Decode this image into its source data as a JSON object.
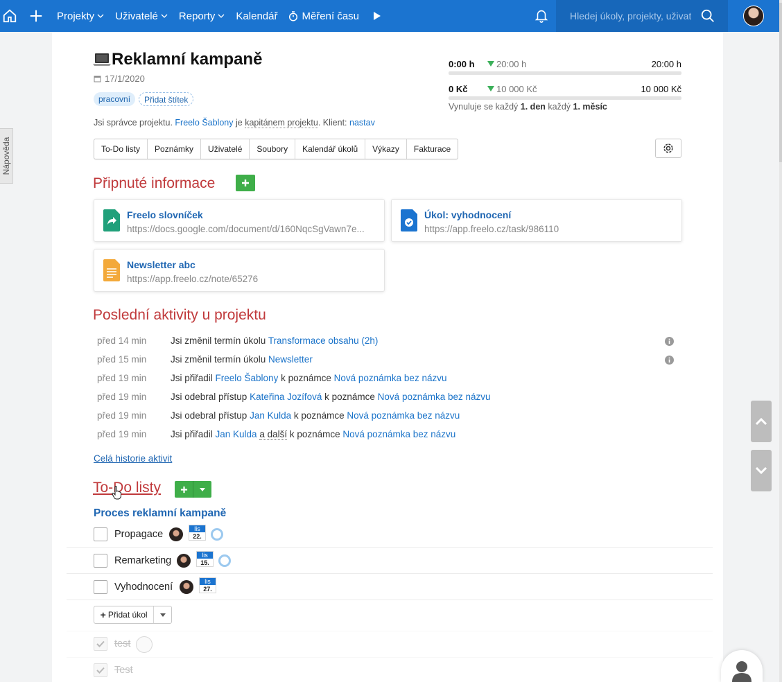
{
  "topnav": {
    "items": [
      {
        "label": "Projekty",
        "dropdown": true
      },
      {
        "label": "Uživatelé",
        "dropdown": true
      },
      {
        "label": "Reporty",
        "dropdown": true
      },
      {
        "label": "Kalendář",
        "dropdown": false
      },
      {
        "label": "Měření času",
        "dropdown": false
      }
    ],
    "search_placeholder": "Hledej úkoly, projekty, uživatele",
    "brand_color": "#1b74d0"
  },
  "help_tab": "Nápověda",
  "project": {
    "icon": "laptop-icon",
    "title": "Reklamní kampaně",
    "date": "17/1/2020",
    "tags": [
      "pracovní"
    ],
    "add_tag": "Přidat štítek",
    "info": {
      "prefix": "Jsi správce projektu.",
      "captain": "Freelo Šablony",
      "middle": "je",
      "captain_role": "kapitánem projektu",
      "client_label": ". Klient:",
      "client_action": "nastav"
    }
  },
  "budget": {
    "time": {
      "spent": "0:00 h",
      "estimate": "20:00 h",
      "total": "20:00 h"
    },
    "money": {
      "spent": "0 Kč",
      "estimate": "10 000 Kč",
      "total": "10 000 Kč"
    },
    "reset": {
      "prefix": "Vynuluje se každý",
      "day": "1. den",
      "middle": "každý",
      "month": "1. měsíc"
    }
  },
  "tabs": [
    "To-Do listy",
    "Poznámky",
    "Uživatelé",
    "Soubory",
    "Kalendář úkolů",
    "Výkazy",
    "Fakturace"
  ],
  "pinned": {
    "heading": "Připnuté informace",
    "items": [
      {
        "icon": "shared-link-icon",
        "title": "Freelo slovníček",
        "url": "https://docs.google.com/document/d/160NqcSgVawn7e..."
      },
      {
        "icon": "task-document-icon",
        "title": "Úkol: vyhodnocení",
        "url": "https://app.freelo.cz/task/986110"
      },
      {
        "icon": "note-document-icon",
        "title": "Newsletter abc",
        "url": "https://app.freelo.cz/note/65276"
      }
    ]
  },
  "activities": {
    "heading": "Poslední aktivity u projektu",
    "rows": [
      {
        "when": "před 14 min",
        "parts": [
          {
            "t": "Jsi změnil termín úkolu "
          },
          {
            "l": "Transformace obsahu (2h)"
          }
        ],
        "info": true
      },
      {
        "when": "před 15 min",
        "parts": [
          {
            "t": "Jsi změnil termín úkolu "
          },
          {
            "l": "Newsletter"
          }
        ],
        "info": true
      },
      {
        "when": "před 19 min",
        "parts": [
          {
            "t": "Jsi přiřadil "
          },
          {
            "l": "Freelo Šablony"
          },
          {
            "t": " k poznámce "
          },
          {
            "l": "Nová poznámka bez názvu"
          }
        ],
        "info": false
      },
      {
        "when": "před 19 min",
        "parts": [
          {
            "t": "Jsi odebral přístup "
          },
          {
            "l": "Kateřina Jozífová"
          },
          {
            "t": " k poznámce "
          },
          {
            "l": "Nová poznámka bez názvu"
          }
        ],
        "info": false
      },
      {
        "when": "před 19 min",
        "parts": [
          {
            "t": "Jsi odebral přístup "
          },
          {
            "l": "Jan Kulda"
          },
          {
            "t": " k poznámce "
          },
          {
            "l": "Nová poznámka bez názvu"
          }
        ],
        "info": false
      },
      {
        "when": "před 19 min",
        "parts": [
          {
            "t": "Jsi přiřadil "
          },
          {
            "l": "Jan Kulda"
          },
          {
            "t": " "
          },
          {
            "u": "a další"
          },
          {
            "t": " k poznámce "
          },
          {
            "l": "Nová poznámka bez názvu"
          }
        ],
        "info": false
      }
    ],
    "history_link": "Celá historie aktivit"
  },
  "todo": {
    "heading": "To-Do listy",
    "list_title": "Proces reklamní kampaně",
    "tasks": [
      {
        "name": "Propagace",
        "month": "lis",
        "day": "22.",
        "ring": true
      },
      {
        "name": "Remarketing",
        "month": "lis",
        "day": "15.",
        "ring": true
      },
      {
        "name": "Vyhodnocení",
        "month": "lis",
        "day": "27.",
        "ring": false
      }
    ],
    "add_task": "Přidat úkol",
    "done": [
      "test",
      "Test"
    ]
  }
}
